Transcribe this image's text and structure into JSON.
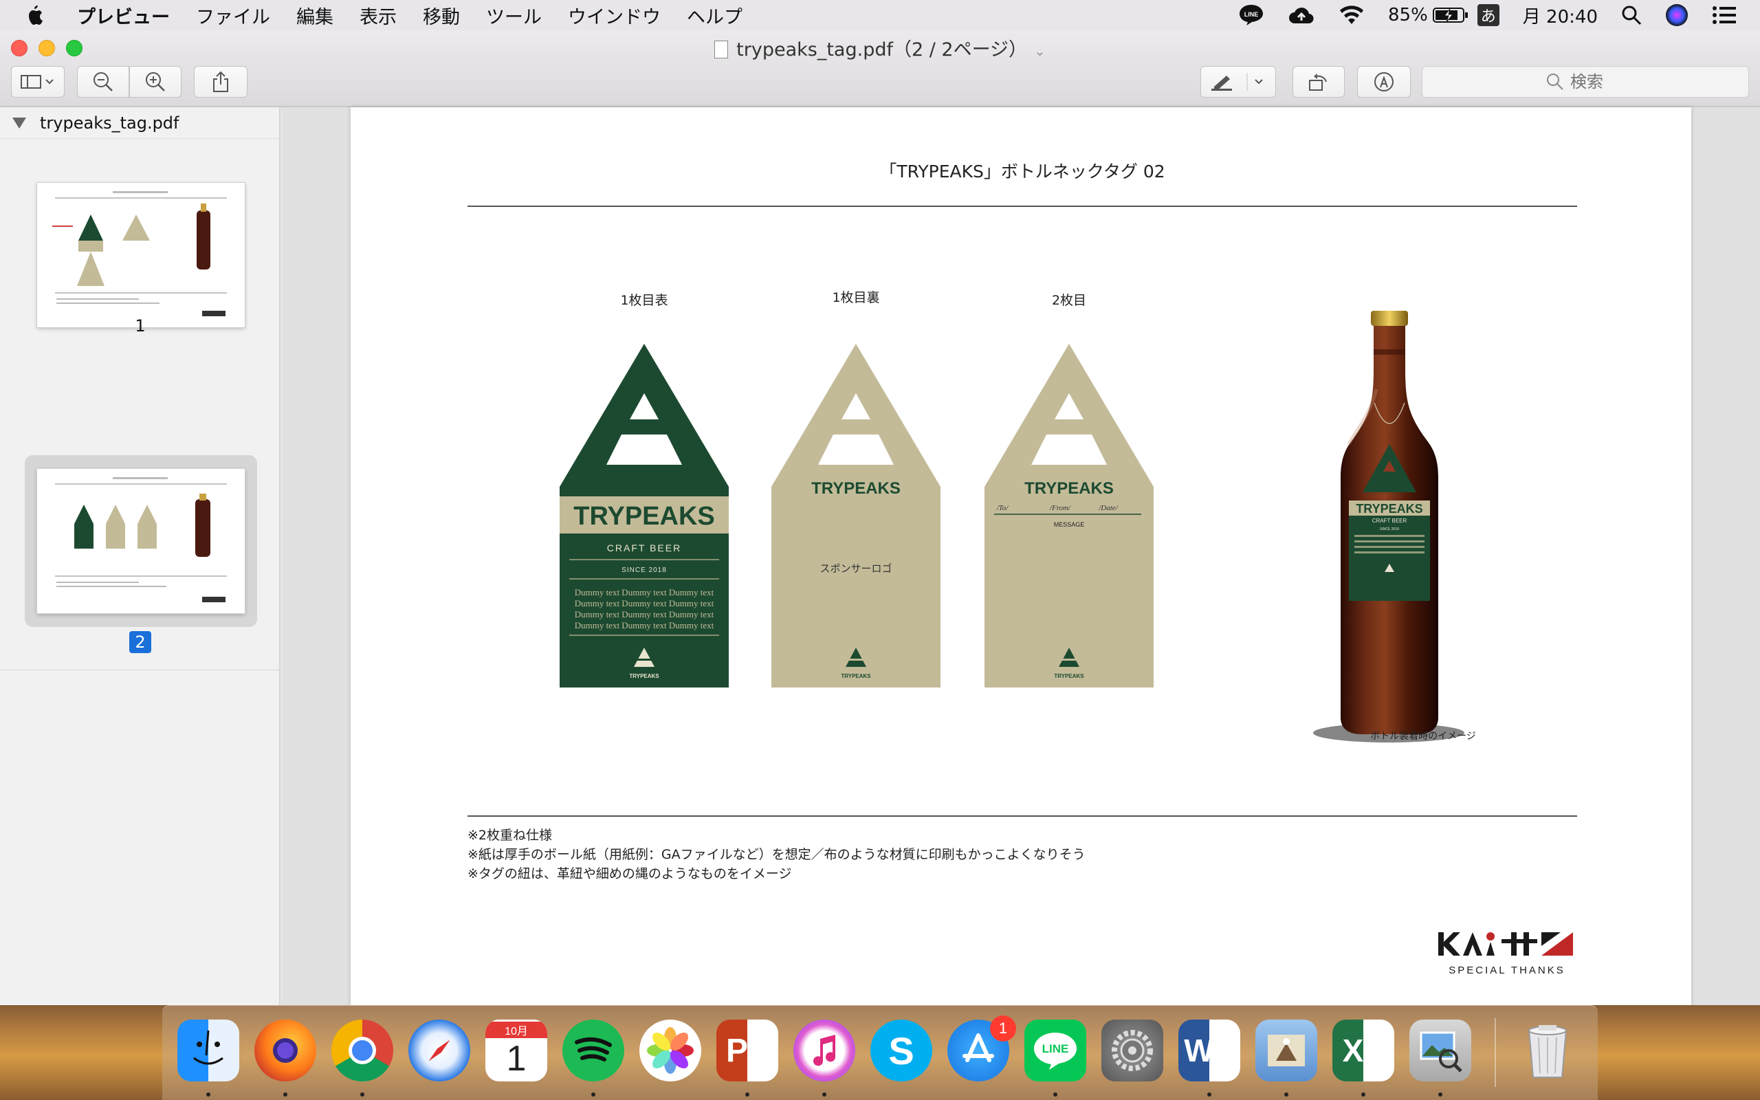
{
  "menubar": {
    "app_name": "プレビュー",
    "items": [
      "ファイル",
      "編集",
      "表示",
      "移動",
      "ツール",
      "ウインドウ",
      "ヘルプ"
    ],
    "status": {
      "line_label": "LINE",
      "battery": "85%",
      "ime": "あ",
      "clock": "月 20:40"
    }
  },
  "window": {
    "title": "trypeaks_tag.pdf（2 / 2ページ）",
    "search_placeholder": "検索"
  },
  "sidebar": {
    "file_name": "trypeaks_tag.pdf",
    "thumbnails": [
      {
        "label": "1",
        "selected": false
      },
      {
        "label": "2",
        "selected": true
      }
    ]
  },
  "page": {
    "heading": "「TRYPEAKS」ボトルネックタグ 02",
    "tags": [
      {
        "caption": "1枚目表",
        "style": "front",
        "brand": "TRYPEAKS",
        "subtitle": "CRAFT BEER",
        "since": "SINCE 2018",
        "body": [
          "Dummy text Dummy text Dummy text",
          "Dummy text Dummy text Dummy text",
          "Dummy text Dummy text Dummy text",
          "Dummy text Dummy text Dummy text"
        ],
        "footer_logo": "TRYPEAKS"
      },
      {
        "caption": "1枚目裏",
        "style": "back",
        "brand": "TRYPEAKS",
        "sponsor": "スポンサーロゴ",
        "footer_logo": "TRYPEAKS"
      },
      {
        "caption": "2枚目",
        "style": "message",
        "brand": "TRYPEAKS",
        "fields": [
          "/To/",
          "/From/",
          "/Date/"
        ],
        "message_label": "MESSAGE",
        "footer_logo": "TRYPEAKS"
      }
    ],
    "bottle": {
      "brand": "TRYPEAKS",
      "subtitle": "CRAFT BEER",
      "since": "SINCE 2018",
      "caption": "ボトル装着時のイメージ"
    },
    "notes": [
      "※2枚重ね仕様",
      "※紙は厚手のボール紙（用紙例：GAファイルなど）を想定／布のような材質に印刷もかっこよくなりそう",
      "※タグの紐は、革紐や細めの縄のようなものをイメージ"
    ],
    "credit": {
      "logo_text": "KAZA",
      "label": "SPECIAL THANKS"
    }
  },
  "dock": {
    "apps": [
      {
        "name": "Finder",
        "running": true
      },
      {
        "name": "Firefox",
        "running": true
      },
      {
        "name": "Chrome",
        "running": true
      },
      {
        "name": "Safari",
        "running": false
      },
      {
        "name": "Calendar",
        "running": false,
        "month": "10月",
        "day": "1"
      },
      {
        "name": "Spotify",
        "running": true
      },
      {
        "name": "Photos",
        "running": false
      },
      {
        "name": "PowerPoint",
        "running": true
      },
      {
        "name": "iTunes",
        "running": true
      },
      {
        "name": "Skype",
        "running": false
      },
      {
        "name": "App Store",
        "running": false,
        "badge": "1"
      },
      {
        "name": "LINE",
        "running": true
      },
      {
        "name": "System Preferences",
        "running": false
      },
      {
        "name": "Word",
        "running": true
      },
      {
        "name": "Mail",
        "running": true
      },
      {
        "name": "Excel",
        "running": true
      },
      {
        "name": "Preview",
        "running": true
      },
      {
        "name": "Trash",
        "running": false
      }
    ]
  },
  "colors": {
    "tag_green": "#1c4a30",
    "tag_beige": "#c3bb98",
    "accent_blue": "#1a6fd8"
  }
}
